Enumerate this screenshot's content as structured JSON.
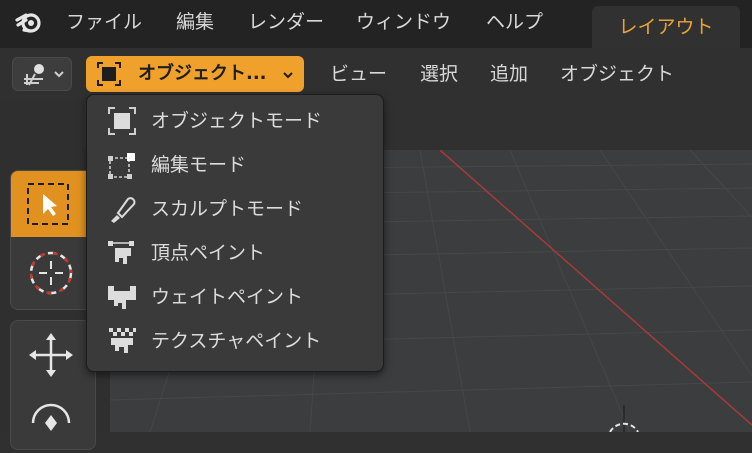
{
  "menubar": {
    "items": [
      "ファイル",
      "編集",
      "レンダー",
      "ウィンドウ",
      "ヘルプ"
    ],
    "workspace_tab": "レイアウト"
  },
  "header": {
    "mode_selector_label": "オブジェクト...",
    "menus": [
      "ビュー",
      "選択",
      "追加",
      "オブジェクト"
    ]
  },
  "mode_dropdown": {
    "items": [
      {
        "label": "オブジェクトモード",
        "icon": "object-mode-icon"
      },
      {
        "label": "編集モード",
        "icon": "edit-mode-icon"
      },
      {
        "label": "スカルプトモード",
        "icon": "sculpt-mode-icon"
      },
      {
        "label": "頂点ペイント",
        "icon": "vertex-paint-icon"
      },
      {
        "label": "ウェイトペイント",
        "icon": "weight-paint-icon"
      },
      {
        "label": "テクスチャペイント",
        "icon": "texture-paint-icon"
      }
    ]
  },
  "colors": {
    "accent": "#f0a12c",
    "topbar": "#232323",
    "viewport": "#3b3d3f",
    "x_axis": "#a83a3a"
  }
}
